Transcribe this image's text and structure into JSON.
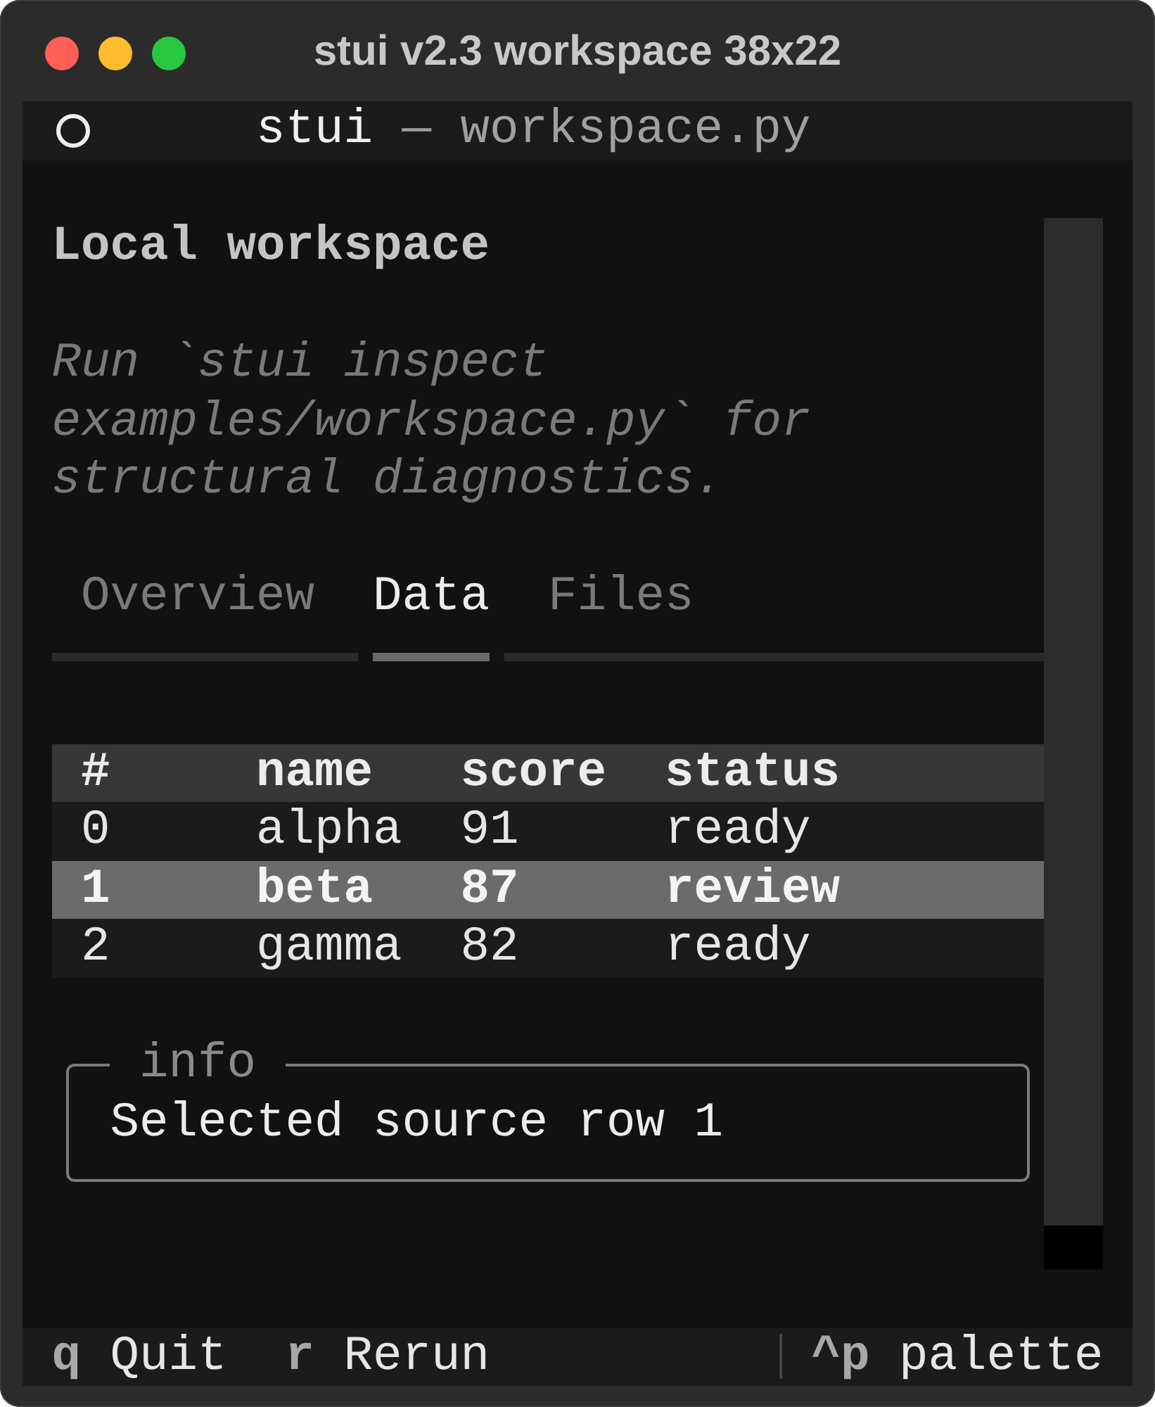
{
  "window": {
    "title": "stui v2.3 workspace 38x22"
  },
  "header": {
    "app": "stui",
    "subtitle": "— workspace.py"
  },
  "heading": "Local workspace",
  "hint": "Run `stui inspect examples/workspace.py` for structural diagnostics.",
  "tabs": [
    {
      "label": "Overview",
      "selected": false
    },
    {
      "label": "Data",
      "selected": true
    },
    {
      "label": "Files",
      "selected": false
    }
  ],
  "table": {
    "columns": [
      "#",
      "name",
      "score",
      "status"
    ],
    "rows": [
      {
        "cells": [
          "0",
          "alpha",
          "91",
          "ready"
        ],
        "selected": false
      },
      {
        "cells": [
          "1",
          "beta",
          "87",
          "review"
        ],
        "selected": true
      },
      {
        "cells": [
          "2",
          "gamma",
          "82",
          "ready"
        ],
        "selected": false
      }
    ]
  },
  "info_panel": {
    "title": "info",
    "text": "Selected source row 1"
  },
  "footer": {
    "bindings": [
      {
        "key": "q",
        "label": "Quit"
      },
      {
        "key": "r",
        "label": "Rerun"
      }
    ],
    "right_bindings": [
      {
        "key": "^p",
        "label": "palette"
      }
    ]
  }
}
